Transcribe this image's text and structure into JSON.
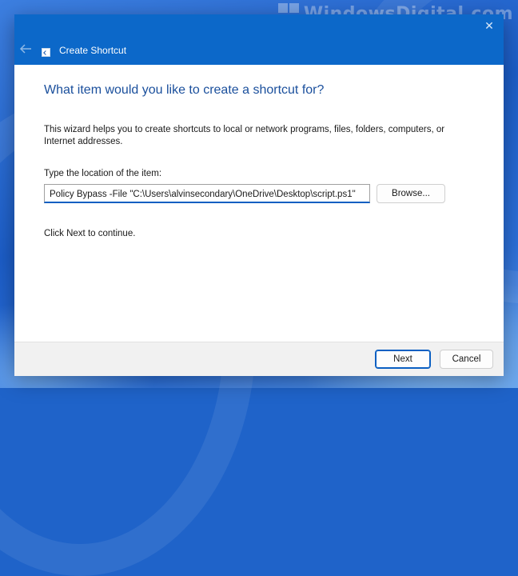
{
  "watermark": {
    "text": "WindowsDigital.com"
  },
  "window": {
    "title": "Create Shortcut",
    "close_glyph": "✕",
    "back_glyph": "←",
    "heading": "What item would you like to create a shortcut for?",
    "description": "This wizard helps you to create shortcuts to local or network programs, files, folders, computers, or Internet addresses.",
    "location_label": "Type the location of the item:",
    "location_value": "Policy Bypass -File \"C:\\Users\\alvinsecondary\\OneDrive\\Desktop\\script.ps1\"",
    "browse_label": "Browse...",
    "continue_text": "Click Next to continue.",
    "next_label": "Next",
    "cancel_label": "Cancel"
  },
  "colors": {
    "titlebar": "#0c68c9",
    "heading": "#1a4f9c",
    "accent": "#0a5fc2"
  },
  "icons": [
    "back-arrow-icon",
    "shortcut-icon",
    "close-icon",
    "windows-logo-icon"
  ]
}
